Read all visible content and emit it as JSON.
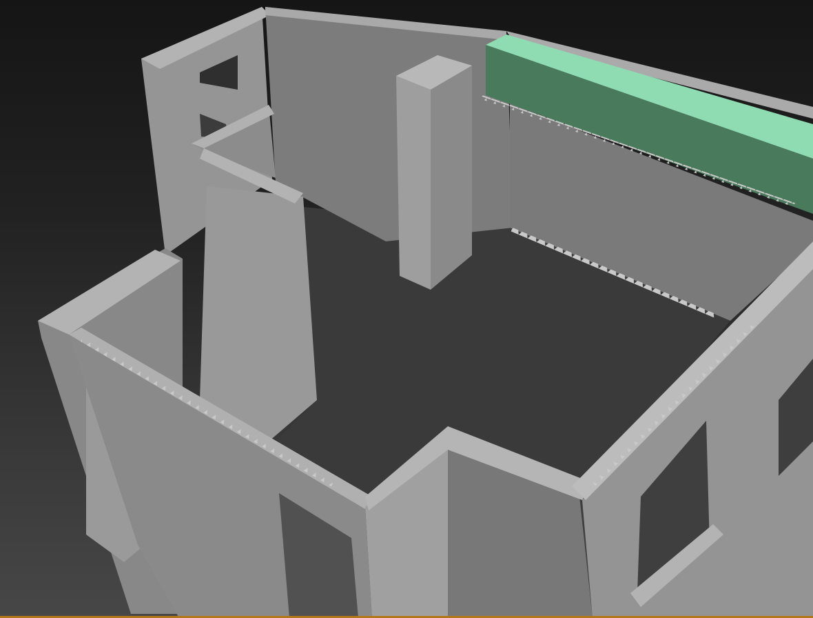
{
  "viewport": {
    "label": "",
    "shading_mode": "shaded",
    "background_colors": [
      "#151515",
      "#474747"
    ],
    "model_colors": {
      "wall_top": "#b2b2b2",
      "wall_face_light": "#9c9c9c",
      "wall_face_mid": "#878787",
      "wall_face_dark": "#727272",
      "floor": "#3b3b3b",
      "selected_beam_top": "#8fdcb3",
      "selected_beam_side": "#4a7a5c"
    },
    "selected_object": "green-beam",
    "bottom_border_color": "#b5771d"
  }
}
